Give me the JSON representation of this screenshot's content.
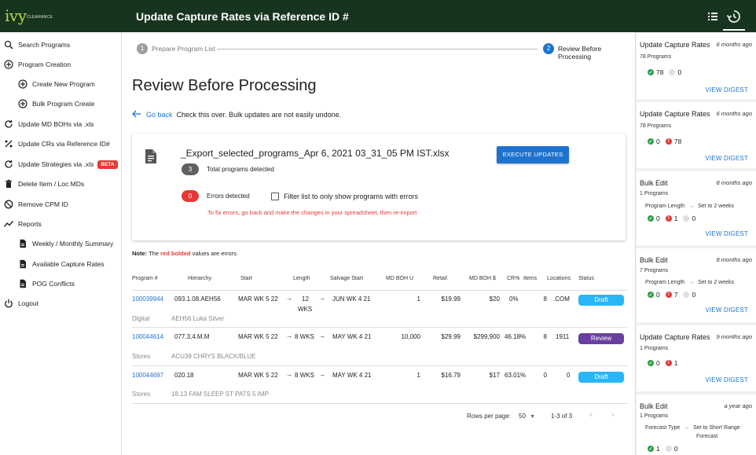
{
  "app": {
    "logo_text": "ivy",
    "logo_sub": "CLEARANCE",
    "title": "Update Capture Rates via Reference ID #"
  },
  "toolbar": {
    "icons": [
      "list-icon",
      "history-icon"
    ]
  },
  "sidebar": {
    "items": [
      {
        "label": "Search Programs",
        "icon": "search-icon"
      },
      {
        "label": "Program Creation",
        "icon": "add-circle-icon"
      },
      {
        "label": "Create New Program",
        "icon": "add-circle-icon"
      },
      {
        "label": "Bulk Program Create",
        "icon": "add-circle-icon"
      },
      {
        "label": "Update MD BOHs via .xls",
        "icon": "refresh-icon"
      },
      {
        "label": "Update CRs via Reference ID#",
        "icon": "percent-icon"
      },
      {
        "label": "Update Strategies via .xls",
        "icon": "refresh-icon",
        "badge": "BETA"
      },
      {
        "label": "Delete Item / Loc MDs",
        "icon": "trash-icon"
      },
      {
        "label": "Remove CPM ID",
        "icon": "block-icon"
      },
      {
        "label": "Reports",
        "icon": "trend-icon"
      },
      {
        "label": "Weekly / Monthly Summary",
        "icon": "document-icon"
      },
      {
        "label": "Available Capture Rates",
        "icon": "document-icon"
      },
      {
        "label": "POG Conflicts",
        "icon": "document-icon"
      },
      {
        "label": "Logout",
        "icon": "power-icon"
      }
    ]
  },
  "stepper": {
    "steps": [
      {
        "num": "1",
        "label": "Prepare Program List",
        "active": false
      },
      {
        "num": "2",
        "label": "Review Before Processing",
        "active": true
      }
    ]
  },
  "page": {
    "title": "Review Before Processing",
    "back_label": "Go back",
    "back_hint": "Check this over. Bulk updates are not easily undone."
  },
  "upload": {
    "file_name": "_Export_selected_programs_Apr 6, 2021 03_31_05 PM IST.xlsx",
    "execute_label": "EXECUTE UPDATES",
    "total_count": "3",
    "total_label": "Total programs detected",
    "error_count": "0",
    "error_label": "Errors detected",
    "filter_label": "Filter list to only show programs with errors",
    "fix_message": "To fix errors, go back and make the changes in your spreadsheet, then re-import"
  },
  "note": {
    "prefix": "Note:",
    "pre": " The ",
    "red": "red bolded",
    "post": " values are errors."
  },
  "table": {
    "headers": [
      "Program #",
      "Hierarchy",
      "Start",
      "Length",
      "Salvage Start",
      "MD BOH U",
      "Retail",
      "MD BOH $",
      "CR%",
      "Items",
      "Locations",
      "Status"
    ],
    "rows": [
      {
        "program": "100039944",
        "hierarchy": "093.1.08.AEH56",
        "start": "MAR WK 5 22",
        "length_a": "12",
        "length_b": "WKS",
        "salvage": "JUN WK 4 21",
        "boh_u": "1",
        "retail": "$19.99",
        "boh_d": "$20",
        "cr": "0%",
        "items": "8",
        "locations": ".COM",
        "status": "Draft",
        "channel": "Digital",
        "desc": "AEH56 Luka Silver"
      },
      {
        "program": "100044614",
        "hierarchy": "077.3,4.M.M",
        "start": "MAR WK 5 22",
        "length": "8 WKS",
        "salvage": "MAY WK 4 21",
        "boh_u": "10,000",
        "retail": "$29.99",
        "boh_d": "$299,900",
        "cr": "46.18%",
        "items": "8",
        "locations": "1911",
        "status": "Review",
        "channel": "Stores",
        "desc": "ACU39 CHRYS BLACK/BLUE"
      },
      {
        "program": "100044697",
        "hierarchy": "020.18",
        "start": "MAR WK 5 22",
        "length": "8 WKS",
        "salvage": "MAY WK 4 21",
        "boh_u": "1",
        "retail": "$16.79",
        "boh_d": "$17",
        "cr": "63.01%",
        "items": "0",
        "locations": "0",
        "status": "Draft",
        "channel": "Stores",
        "desc": "18.13 FAM SLEEP ST PATS 5 IMP"
      }
    ],
    "status_colors": {
      "Draft": "#29b6f6",
      "Review": "#6a3fa0"
    }
  },
  "pagination": {
    "rows_per_page_label": "Rows per page:",
    "rows_per_page": "50",
    "range": "1-3 of 3"
  },
  "digests": [
    {
      "title": "Update Capture Rates",
      "time": "6 months ago",
      "programs": "78 Programs",
      "ok": "78",
      "err": null,
      "skip": "0",
      "link": "VIEW DIGEST"
    },
    {
      "title": "Update Capture Rates",
      "time": "6 months ago",
      "programs": "78 Programs",
      "ok": "0",
      "err": "78",
      "skip": null,
      "link": "VIEW DIGEST"
    },
    {
      "title": "Bulk Edit",
      "time": "8 months ago",
      "programs": "1 Programs",
      "detail_label": "Program Length",
      "detail_value": "Set to 2 weeks",
      "ok": "0",
      "err": "1",
      "skip": "0",
      "link": "VIEW DIGEST"
    },
    {
      "title": "Bulk Edit",
      "time": "8 months ago",
      "programs": "7 Programs",
      "detail_label": "Program Length",
      "detail_value": "Set to 2 weeks",
      "ok": "0",
      "err": "7",
      "skip": "0",
      "link": "VIEW DIGEST"
    },
    {
      "title": "Update Capture Rates",
      "time": "9 months ago",
      "programs": "1 Programs",
      "ok": "0",
      "err": "1",
      "skip": null,
      "link": "VIEW DIGEST"
    },
    {
      "title": "Bulk Edit",
      "time": "a year ago",
      "programs": "1 Programs",
      "detail_label": "Forecast Type",
      "detail_value": "Set to Short Range",
      "detail_value2": "Forecast",
      "ok": "1",
      "err": null,
      "skip": "0",
      "link": null
    }
  ]
}
